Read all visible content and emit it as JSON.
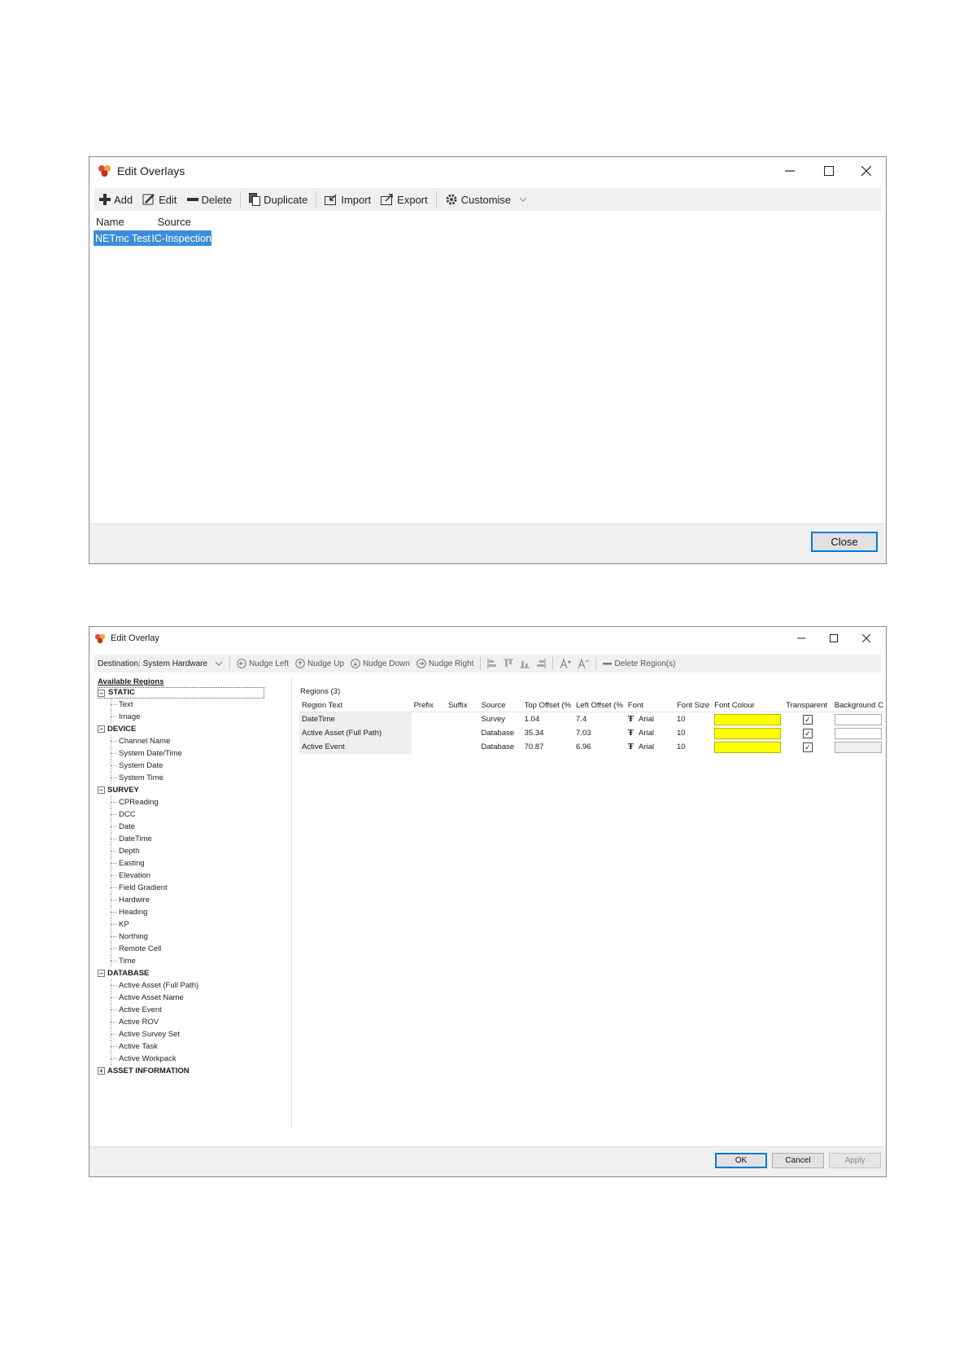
{
  "overlays_window": {
    "title": "Edit Overlays",
    "toolbar": {
      "add": "Add",
      "edit": "Edit",
      "delete": "Delete",
      "duplicate": "Duplicate",
      "import": "Import",
      "export": "Export",
      "customise": "Customise"
    },
    "columns": {
      "name": "Name",
      "source": "Source"
    },
    "rows": [
      {
        "name": "NETmc Test",
        "source": "IC-Inspection"
      }
    ],
    "close_label": "Close"
  },
  "overlay_window": {
    "title": "Edit Overlay",
    "toolbar": {
      "destination": "Destination: System Hardware",
      "nudge_left": "Nudge Left",
      "nudge_up": "Nudge Up",
      "nudge_down": "Nudge Down",
      "nudge_right": "Nudge Right",
      "delete_regions": "Delete Region(s)"
    },
    "available_regions_label": "Available Regions",
    "tree": {
      "static": {
        "label": "STATIC",
        "items": [
          "Text",
          "Image"
        ]
      },
      "device": {
        "label": "DEVICE",
        "items": [
          "Channel Name",
          "System Date/Time",
          "System Date",
          "System Time"
        ]
      },
      "survey": {
        "label": "SURVEY",
        "items": [
          "CPReading",
          "DCC",
          "Date",
          "DateTime",
          "Depth",
          "Easting",
          "Elevation",
          "Field Gradient",
          "Hardwire",
          "Heading",
          "KP",
          "Northing",
          "Remote Cell",
          "Time"
        ]
      },
      "database": {
        "label": "DATABASE",
        "items": [
          "Active Asset (Full Path)",
          "Active Asset Name",
          "Active Event",
          "Active ROV",
          "Active Survey Set",
          "Active Task",
          "Active Workpack"
        ]
      },
      "asset_information": {
        "label": "ASSET INFORMATION"
      }
    },
    "regions_title": "Regions (3)",
    "columns": [
      "Region Text",
      "Prefix",
      "Suffix",
      "Source",
      "Top Offset (%",
      "Left Offset (%",
      "Font",
      "Font Size",
      "Font Colour",
      "Transparent",
      "Background C"
    ],
    "regions": [
      {
        "text": "DateTime",
        "prefix": "",
        "suffix": "",
        "source": "Survey",
        "top": "1.04",
        "left": "7.4",
        "font": "Arial",
        "size": "10",
        "font_colour": "#ffff00",
        "transparent": true
      },
      {
        "text": "Active Asset (Full Path)",
        "prefix": "",
        "suffix": "",
        "source": "Database",
        "top": "35.34",
        "left": "7.03",
        "font": "Arial",
        "size": "10",
        "font_colour": "#ffff00",
        "transparent": true
      },
      {
        "text": "Active Event",
        "prefix": "",
        "suffix": "",
        "source": "Database",
        "top": "70.87",
        "left": "6.96",
        "font": "Arial",
        "size": "10",
        "font_colour": "#ffff00",
        "transparent": true
      }
    ],
    "buttons": {
      "ok": "OK",
      "cancel": "Cancel",
      "apply": "Apply"
    }
  }
}
